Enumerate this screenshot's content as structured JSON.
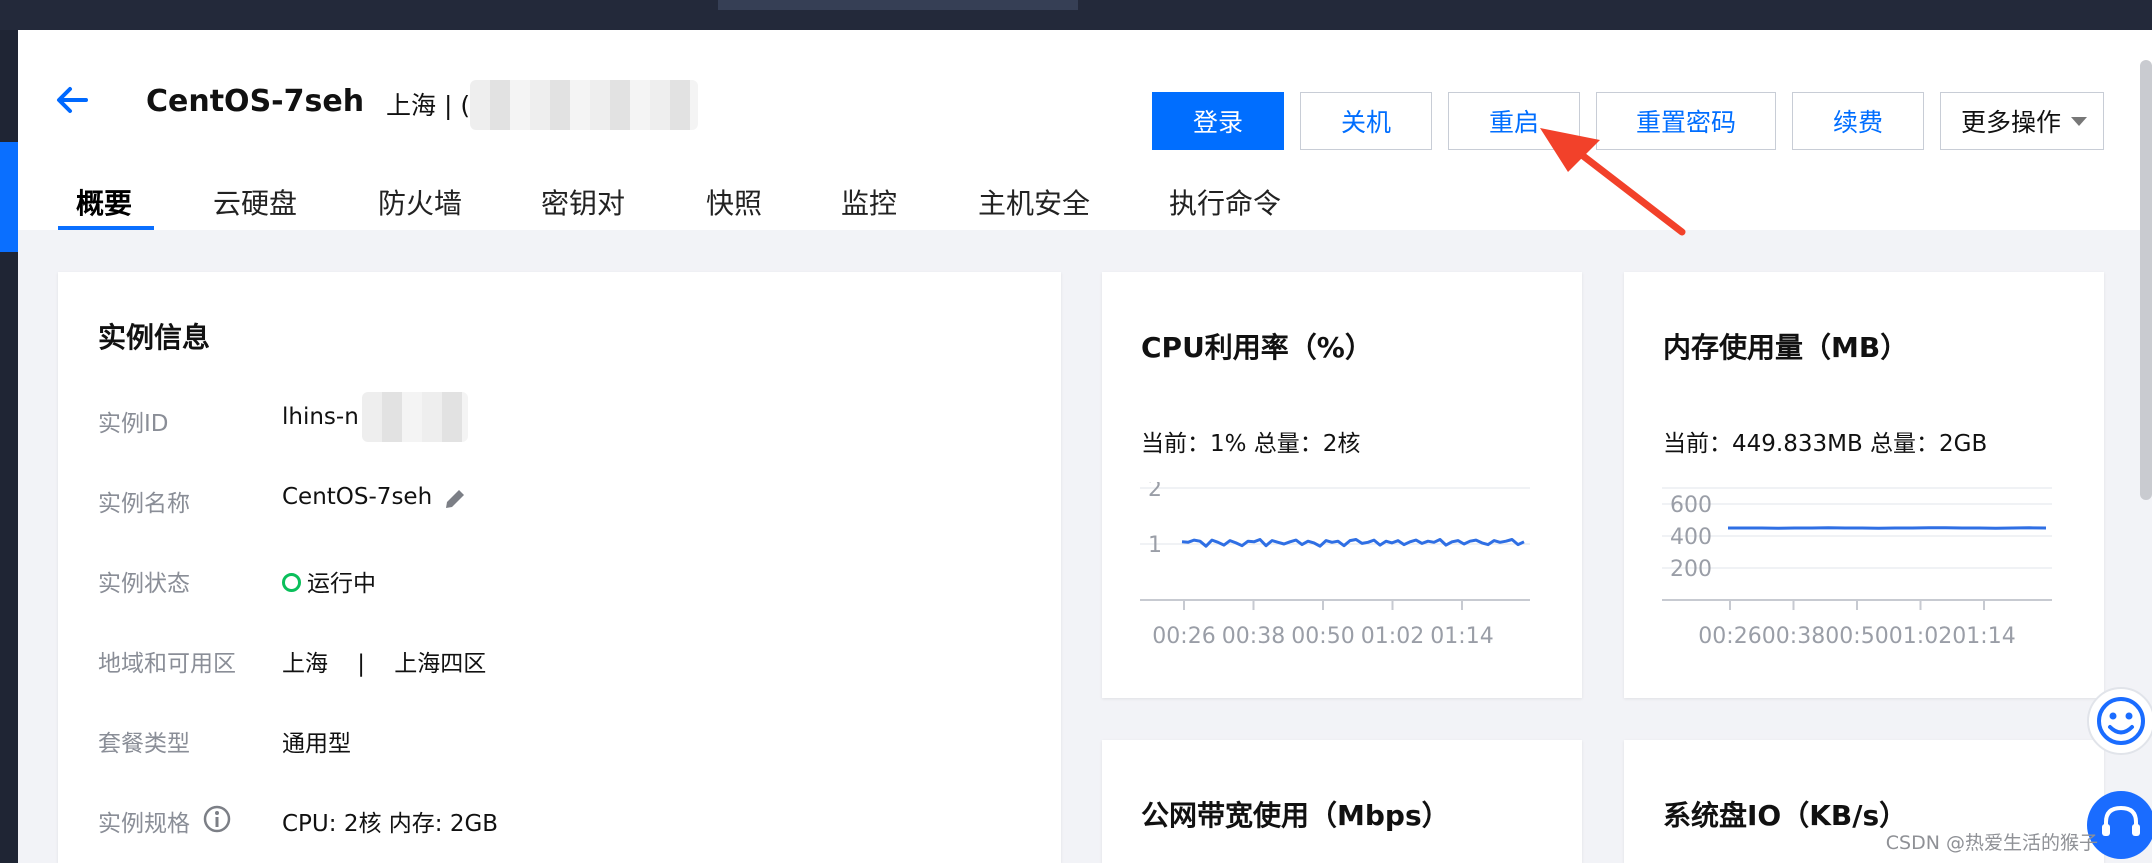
{
  "header": {
    "title": "CentOS-7seh",
    "region_prefix": "上海 | (",
    "region_partial": "i",
    "buttons": {
      "login": "登录",
      "shutdown": "关机",
      "restart": "重启",
      "reset_password": "重置密码",
      "renew": "续费",
      "more": "更多操作"
    }
  },
  "tabs": [
    "概要",
    "云硬盘",
    "防火墙",
    "密钥对",
    "快照",
    "监控",
    "主机安全",
    "执行命令"
  ],
  "instance_info": {
    "title": "实例信息",
    "rows": [
      {
        "label": "实例ID",
        "value": "lhins-n"
      },
      {
        "label": "实例名称",
        "value": "CentOS-7seh"
      },
      {
        "label": "实例状态",
        "value": "运行中"
      },
      {
        "label": "地域和可用区",
        "value": "上海    |    上海四区"
      },
      {
        "label": "套餐类型",
        "value": "通用型"
      },
      {
        "label": "实例规格",
        "value": "CPU: 2核 内存: 2GB"
      }
    ]
  },
  "cpu_card": {
    "title": "CPU利用率（%）",
    "stat": "当前：1% 总量：2核"
  },
  "mem_card": {
    "title": "内存使用量（MB）",
    "stat": "当前：449.833MB 总量：2GB"
  },
  "net_card": {
    "title": "公网带宽使用（Mbps）"
  },
  "disk_card": {
    "title": "系统盘IO（KB/s）"
  },
  "chart_data": [
    {
      "type": "line",
      "title": "CPU利用率（%）",
      "x": [
        "00:26",
        "00:38",
        "00:50",
        "01:02",
        "01:14"
      ],
      "yticks": [
        1,
        2
      ],
      "ylim": [
        0,
        2
      ],
      "series": [
        {
          "values": [
            1.04,
            1.03,
            1.07,
            1.05,
            0.96,
            1.07,
            1.03,
            0.98,
            1.06,
            1.02,
            0.97,
            1.05,
            1.04,
            1.08,
            0.97,
            1.06,
            1.03,
            1.0,
            1.04,
            1.07,
            0.99,
            1.05,
            1.02,
            0.96,
            1.06,
            1.03,
            1.05,
            0.97,
            1.06,
            1.08,
            1.01,
            1.03,
            1.07,
            0.98,
            1.05,
            1.02,
            1.06,
            0.99,
            1.04,
            1.07,
            1.01,
            1.05,
            1.03,
            1.08,
            0.98,
            1.04,
            1.06,
            1.0,
            1.05,
            1.07,
            1.02,
            0.99,
            1.06,
            1.03,
            1.05,
            1.08,
            0.99,
            1.04
          ],
          "color": "#2f6fe4"
        }
      ]
    },
    {
      "type": "line",
      "title": "内存使用量（MB）",
      "x": [
        "00:26",
        "00:38",
        "00:50",
        "01:02",
        "01:14"
      ],
      "yticks": [
        200,
        400,
        600
      ],
      "ylim": [
        0,
        700
      ],
      "series": [
        {
          "values": [
            450,
            450,
            450,
            449,
            450,
            450,
            451,
            450,
            450,
            449,
            450,
            450,
            451,
            452,
            450,
            450,
            449,
            450,
            451,
            450
          ],
          "color": "#2f6fe4"
        }
      ]
    }
  ],
  "watermark": "CSDN @热爱生活的猴子",
  "colors": {
    "primary": "#006eff",
    "status_green": "#0abf5b",
    "annotation_red": "#f2412a"
  }
}
